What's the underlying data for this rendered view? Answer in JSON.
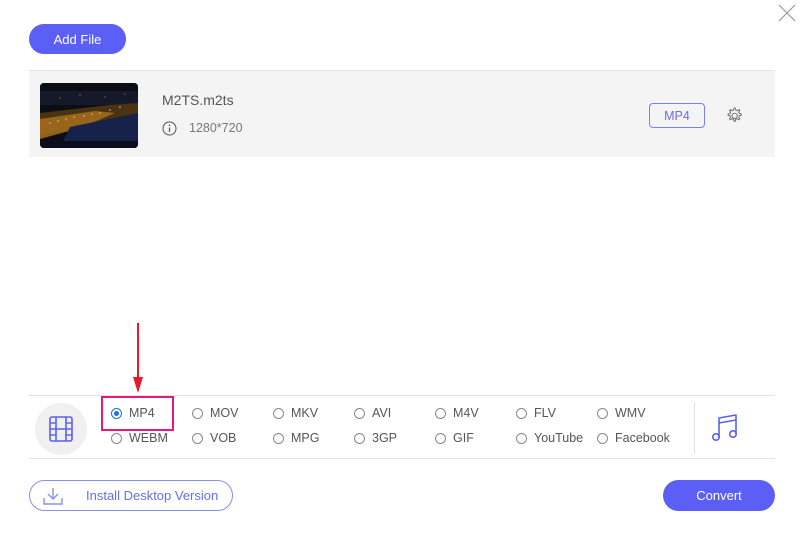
{
  "window": {
    "close_icon": "close-icon"
  },
  "toolbar": {
    "add_file_label": "Add File"
  },
  "file": {
    "name": "M2TS.m2ts",
    "resolution": "1280*720",
    "output_format": "MP4",
    "info_icon": "info-icon",
    "settings_icon": "gear-icon"
  },
  "formats": {
    "selected": "MP4",
    "video_tab_icon": "film-icon",
    "audio_tab_icon": "music-note-icon",
    "options": [
      {
        "label": "MP4",
        "checked": true
      },
      {
        "label": "MOV",
        "checked": false
      },
      {
        "label": "MKV",
        "checked": false
      },
      {
        "label": "AVI",
        "checked": false
      },
      {
        "label": "M4V",
        "checked": false
      },
      {
        "label": "FLV",
        "checked": false
      },
      {
        "label": "WMV",
        "checked": false
      },
      {
        "label": "WEBM",
        "checked": false
      },
      {
        "label": "VOB",
        "checked": false
      },
      {
        "label": "MPG",
        "checked": false
      },
      {
        "label": "3GP",
        "checked": false
      },
      {
        "label": "GIF",
        "checked": false
      },
      {
        "label": "YouTube",
        "checked": false
      },
      {
        "label": "Facebook",
        "checked": false
      }
    ]
  },
  "footer": {
    "install_label": "Install Desktop Version",
    "convert_label": "Convert"
  },
  "colors": {
    "accent": "#5b5ff5",
    "highlight": "#e8197d",
    "annotation_arrow": "#e8192c",
    "radio_selected": "#1a73e8"
  }
}
